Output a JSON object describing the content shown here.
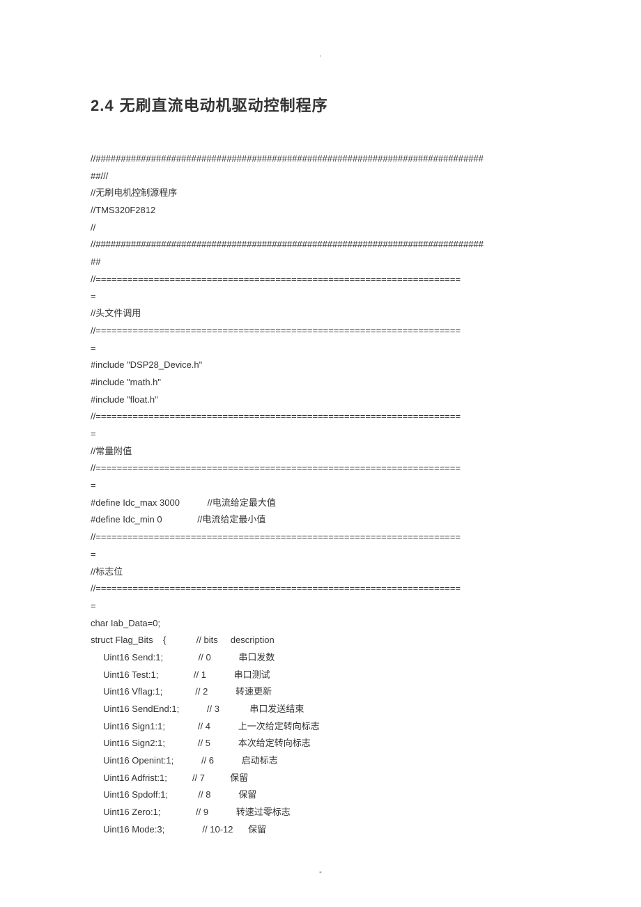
{
  "header": {
    "top_mark": ".",
    "section_number": "2.4",
    "section_title": "无刷直流电动机驱动控制程序"
  },
  "code": "//#############################################################################\n##///\n//无刷电机控制源程序\n//TMS320F2812\n//\n//#############################################################################\n##\n//=====================================================================\n=\n//头文件调用\n//=====================================================================\n=\n#include \"DSP28_Device.h\"\n#include \"math.h\"\n#include \"float.h\"\n//=====================================================================\n=\n//常量附值\n//=====================================================================\n=\n#define Idc_max 3000           //电流给定最大值\n#define Idc_min 0              //电流给定最小值\n//=====================================================================\n=\n//标志位\n//=====================================================================\n=\nchar Iab_Data=0;\nstruct Flag_Bits    {            // bits     description\n     Uint16 Send:1;              // 0           串口发数\n     Uint16 Test:1;              // 1           串口测试\n     Uint16 Vflag:1;             // 2           转速更新\n     Uint16 SendEnd:1;           // 3            串口发送结束\n     Uint16 Sign1:1;             // 4           上一次给定转向标志\n     Uint16 Sign2:1;             // 5           本次给定转向标志\n     Uint16 Openint:1;           // 6           启动标志\n     Uint16 Adfrist:1;          // 7          保留\n     Uint16 Spdoff:1;            // 8           保留\n     Uint16 Zero:1;              // 9           转速过零标志\n     Uint16 Mode:3;               // 10-12      保留",
  "footer": {
    "bottom_mark": "-"
  }
}
